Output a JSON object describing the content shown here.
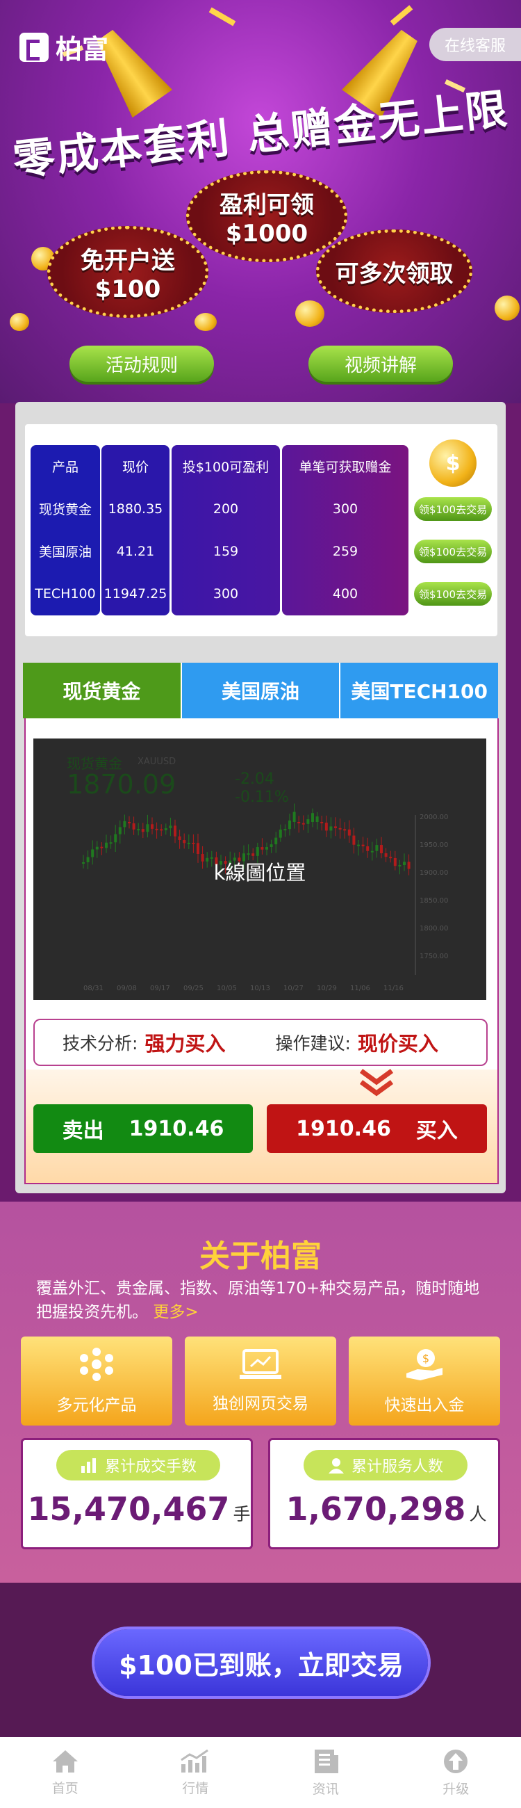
{
  "header": {
    "brand": "柏富",
    "service_button": "在线客服"
  },
  "hero": {
    "headline": "零成本套利 总赠金无上限",
    "badge_left": {
      "line1": "免开户送",
      "line2": "$100"
    },
    "badge_center": {
      "line1": "盈利可领",
      "line2": "$1000"
    },
    "badge_right": {
      "line1": "可多次领取"
    },
    "buttons": {
      "rules": "活动规则",
      "video": "视频讲解"
    }
  },
  "table": {
    "headers": {
      "product": "产品",
      "price": "现价",
      "profit": "投$100可盈利",
      "bonus": "单笔可获取赠金"
    },
    "rows": [
      {
        "product": "现货黄金",
        "price": "1880.35",
        "profit": "200",
        "bonus": "300",
        "action": "领$100去交易"
      },
      {
        "product": "美国原油",
        "price": "41.21",
        "profit": "159",
        "bonus": "259",
        "action": "领$100去交易"
      },
      {
        "product": "TECH100",
        "price": "11947.25",
        "profit": "300",
        "bonus": "400",
        "action": "领$100去交易"
      }
    ]
  },
  "tabs": [
    {
      "label": "现货黄金",
      "active": true
    },
    {
      "label": "美国原油",
      "active": false
    },
    {
      "label": "美国TECH100",
      "active": false
    }
  ],
  "kchart": {
    "symbol": "现货黄金",
    "code": "XAUUSD",
    "price": "1870.09",
    "change": "-2.04",
    "change_pct": "-0.11%",
    "placeholder": "k線圖位置",
    "y_ticks": [
      "2000.00",
      "1950.00",
      "1900.00",
      "1850.00",
      "1800.00",
      "1750.00"
    ],
    "x_ticks": [
      "08/31",
      "09/08",
      "09/17",
      "09/25",
      "10/05",
      "10/13",
      "10/27",
      "10/29",
      "11/06",
      "11/16"
    ]
  },
  "analysis": {
    "label1": "技术分析:",
    "value1": "强力买入",
    "label2": "操作建议:",
    "value2": "现价买入"
  },
  "trade": {
    "sell_label": "卖出",
    "sell_price": "1910.46",
    "buy_price": "1910.46",
    "buy_label": "买入"
  },
  "about": {
    "title": "关于柏富",
    "desc": "覆盖外汇、贵金属、指数、原油等170+种交易产品，随时随地把握投资先机。",
    "more": "更多>",
    "features": [
      "多元化产品",
      "独创网页交易",
      "快速出入金"
    ]
  },
  "stats": [
    {
      "label": "累计成交手数",
      "value": "15,470,467",
      "unit": "手"
    },
    {
      "label": "累计服务人数",
      "value": "1,670,298",
      "unit": "人"
    }
  ],
  "cta": "$100已到账，立即交易",
  "tabbar": [
    "首页",
    "行情",
    "资讯",
    "升级"
  ],
  "colors": {
    "purple": "#8a25a8",
    "green": "#4e9a1a",
    "blue": "#2f9bf0",
    "red": "#c01414",
    "gold": "#ffd23a"
  }
}
